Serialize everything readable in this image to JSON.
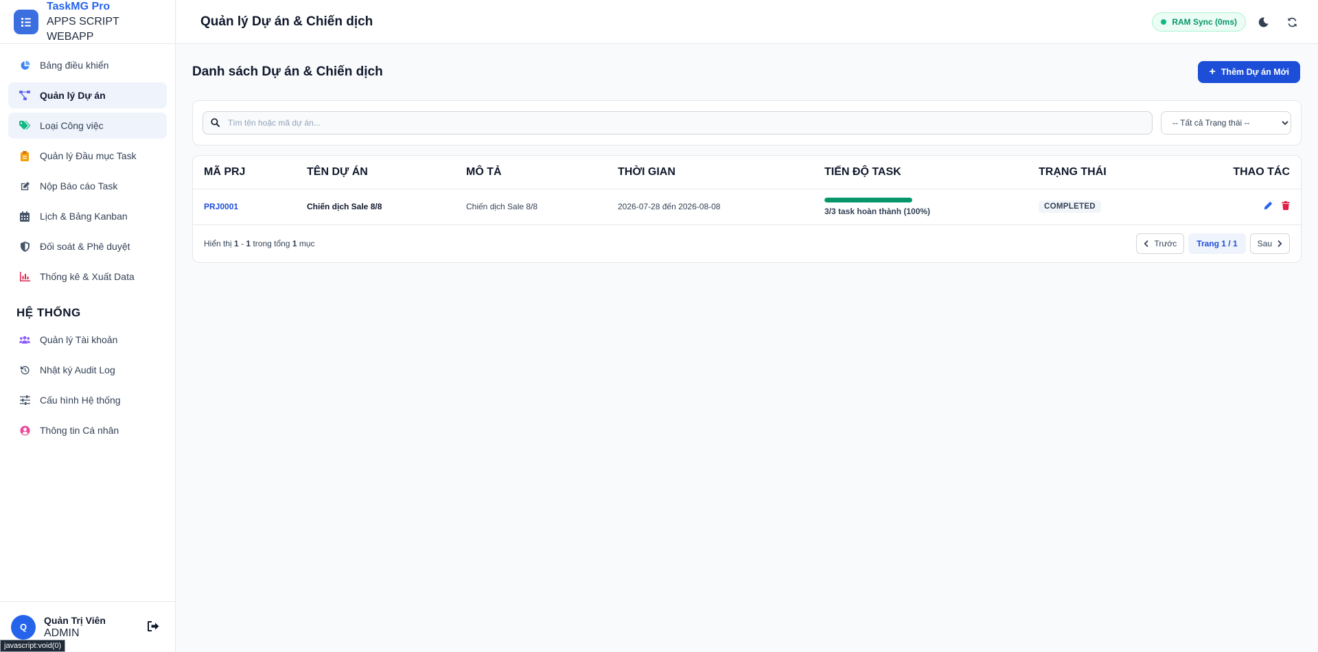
{
  "brand": {
    "name": "TaskMG Pro",
    "sub_line1": "APPS SCRIPT",
    "sub_line2": "WEBAPP"
  },
  "sidebar": {
    "items": [
      {
        "label": "Bảng điều khiển",
        "icon": "pie-chart-icon"
      },
      {
        "label": "Quản lý Dự án",
        "icon": "project-diagram-icon"
      },
      {
        "label": "Loại Công việc",
        "icon": "tags-icon"
      },
      {
        "label": "Quản lý Đầu mục Task",
        "icon": "clipboard-icon"
      },
      {
        "label": "Nộp Báo cáo Task",
        "icon": "edit-icon"
      },
      {
        "label": "Lịch & Bảng Kanban",
        "icon": "calendar-icon"
      },
      {
        "label": "Đối soát & Phê duyệt",
        "icon": "shield-icon"
      },
      {
        "label": "Thống kê & Xuất Data",
        "icon": "bar-chart-icon"
      }
    ],
    "system_title": "HỆ THỐNG",
    "system_items": [
      {
        "label": "Quản lý Tài khoản",
        "icon": "users-icon"
      },
      {
        "label": "Nhật ký Audit Log",
        "icon": "history-icon"
      },
      {
        "label": "Cấu hình Hệ thống",
        "icon": "sliders-icon"
      },
      {
        "label": "Thông tin Cá nhân",
        "icon": "user-circle-icon"
      }
    ]
  },
  "user": {
    "initial": "Q",
    "name": "Quản Trị Viên",
    "role": "ADMIN"
  },
  "status_tip": "javascript:void(0)",
  "header": {
    "title": "Quản lý Dự án & Chiến dịch",
    "sync_label": "RAM Sync (0ms)"
  },
  "page": {
    "title": "Danh sách Dự án & Chiến dịch",
    "add_label": "Thêm Dự án Mới",
    "search_placeholder": "Tìm tên hoặc mã dự án...",
    "status_filter": "-- Tất cả Trạng thái --"
  },
  "table": {
    "columns": [
      "MÃ PRJ",
      "TÊN DỰ ÁN",
      "MÔ TẢ",
      "THỜI GIAN",
      "TIẾN ĐỘ TASK",
      "TRẠNG THÁI",
      "THAO TÁC"
    ],
    "rows": [
      {
        "code": "PRJ0001",
        "name": "Chiến dịch Sale 8/8",
        "description": "Chiến dịch Sale 8/8",
        "period": "2026-07-28 đến 2026-08-08",
        "progress_percent": 100,
        "progress_text": "3/3 task hoàn thành (100%)",
        "status": "COMPLETED"
      }
    ]
  },
  "footer": {
    "prefix": "Hiển thị",
    "from": "1",
    "dash": "-",
    "to": "1",
    "mid": "trong tổng",
    "total": "1",
    "suffix": "mục",
    "prev_label": "Trước",
    "page_label": "Trang 1 / 1",
    "next_label": "Sau"
  },
  "colors": {
    "accent": "#2563eb",
    "success": "#059669",
    "danger": "#e11d48"
  }
}
